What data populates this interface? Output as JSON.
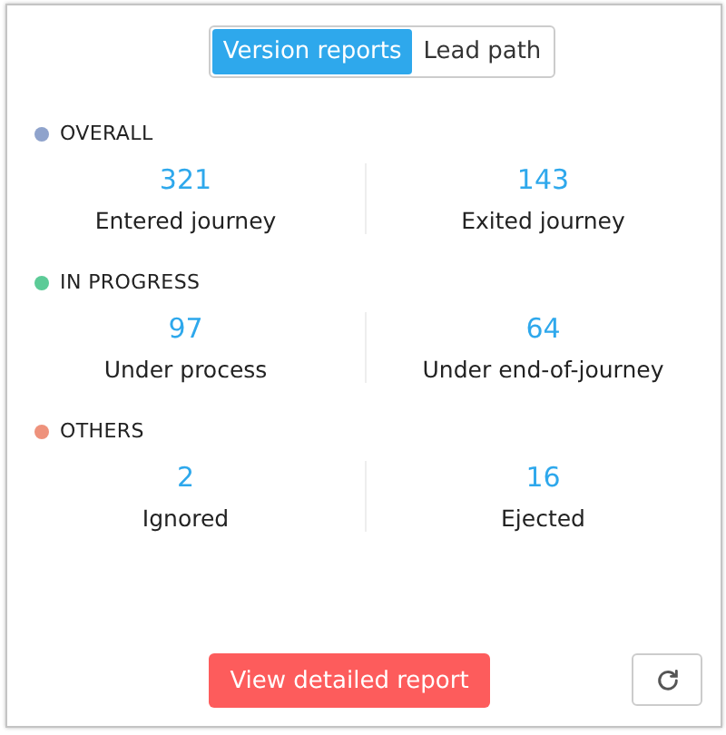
{
  "tabs": [
    {
      "label": "Version reports",
      "selected": true
    },
    {
      "label": "Lead path",
      "selected": false
    }
  ],
  "sections": [
    {
      "title": "OVERALL",
      "color": "#8fa3cc",
      "stats": [
        {
          "value": "321",
          "label": "Entered journey"
        },
        {
          "value": "143",
          "label": "Exited journey"
        }
      ]
    },
    {
      "title": "IN PROGRESS",
      "color": "#5ccb97",
      "stats": [
        {
          "value": "97",
          "label": "Under process"
        },
        {
          "value": "64",
          "label": "Under end-of-journey"
        }
      ]
    },
    {
      "title": "OTHERS",
      "color": "#ee927c",
      "stats": [
        {
          "value": "2",
          "label": "Ignored"
        },
        {
          "value": "16",
          "label": "Ejected"
        }
      ]
    }
  ],
  "primary_button": "View detailed report"
}
